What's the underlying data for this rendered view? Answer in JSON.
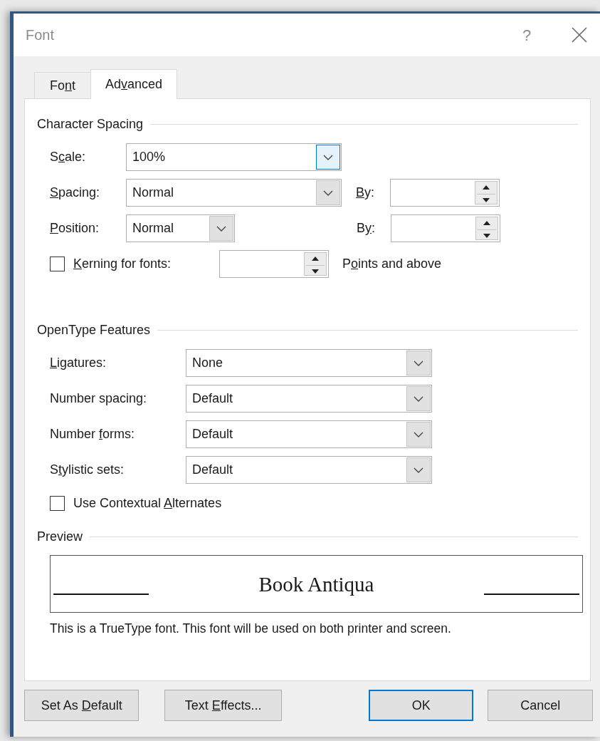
{
  "window": {
    "title": "Font",
    "help": "?"
  },
  "tabs": [
    {
      "label": {
        "pre": "Fo",
        "key": "n",
        "post": "t"
      },
      "selected": false
    },
    {
      "label": {
        "pre": "Ad",
        "key": "v",
        "post": "anced"
      },
      "selected": true
    }
  ],
  "character_spacing": {
    "heading": "Character Spacing",
    "rows": [
      {
        "kind": "combo",
        "label": {
          "pre": "S",
          "key": "c",
          "post": "ale:"
        },
        "value": "100%",
        "focused": true
      },
      {
        "kind": "combo_by",
        "label": {
          "key": "S",
          "post": "pacing:"
        },
        "value": "Normal",
        "focused": false,
        "by_label": {
          "key": "B",
          "post": "y:"
        }
      },
      {
        "kind": "short_combo_by",
        "label": {
          "key": "P",
          "post": "osition:"
        },
        "value": "Normal",
        "focused": false,
        "by_label": {
          "pre": "B",
          "key": "y",
          "post": ":"
        }
      },
      {
        "kind": "checkbox_spin",
        "label": {
          "key": "K",
          "post": "erning for fonts:"
        },
        "checked": false,
        "suffix": {
          "pre": "P",
          "key": "o",
          "post": "ints and above"
        }
      }
    ]
  },
  "opentype_features": {
    "heading": "OpenType Features",
    "rows": [
      {
        "kind": "combo",
        "label": {
          "key": "L",
          "post": "igatures:"
        },
        "value": "None",
        "focused": false
      },
      {
        "kind": "combo",
        "label": {
          "pre": "Number spacing:"
        },
        "value": "Default",
        "focused": false
      },
      {
        "kind": "combo",
        "label": {
          "pre": "Number ",
          "key": "f",
          "post": "orms:"
        },
        "value": "Default",
        "focused": false
      },
      {
        "kind": "combo",
        "label": {
          "pre": "S",
          "key": "t",
          "post": "ylistic sets:"
        },
        "value": "Default",
        "focused": false
      },
      {
        "kind": "checkbox",
        "label": {
          "pre": "Use Contextual ",
          "key": "A",
          "post": "lternates"
        },
        "checked": false
      }
    ]
  },
  "preview": {
    "heading": "Preview",
    "sample": "Book Antiqua",
    "note": "This is a TrueType font. This font will be used on both printer and screen."
  },
  "buttons": [
    {
      "label": {
        "pre": "Set As ",
        "key": "D",
        "post": "efault"
      },
      "default": false
    },
    {
      "label": {
        "pre": "Text ",
        "key": "E",
        "post": "ffects..."
      },
      "default": false
    },
    {
      "label": {
        "pre": "OK"
      },
      "default": true
    },
    {
      "label": {
        "pre": "Cancel"
      },
      "default": false
    }
  ]
}
